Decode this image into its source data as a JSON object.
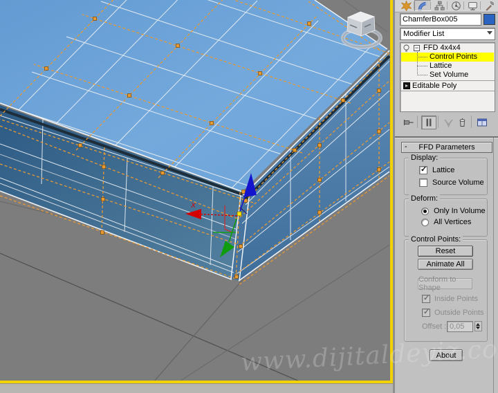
{
  "command_panel": {
    "tabs": [
      {
        "name": "create",
        "icon": "create-icon",
        "active": false
      },
      {
        "name": "modify",
        "icon": "modify-icon",
        "active": true
      },
      {
        "name": "hierarchy",
        "icon": "hierarchy-icon",
        "active": false
      },
      {
        "name": "motion",
        "icon": "motion-icon",
        "active": false
      },
      {
        "name": "display",
        "icon": "display-icon",
        "active": false
      },
      {
        "name": "utilities",
        "icon": "utilities-icon",
        "active": false
      }
    ],
    "object_name": "ChamferBox005",
    "object_color": "#2b63c1",
    "modifier_list_label": "Modifier List",
    "modifier_stack": {
      "modifier": "FFD 4x4x4",
      "sub_items": [
        "Control Points",
        "Lattice",
        "Set Volume"
      ],
      "selected_sub_item": "Control Points",
      "base_object": "Editable Poly"
    },
    "stack_tools": [
      "pin-stack",
      "show-end-result",
      "make-unique",
      "remove-modifier",
      "configure-modifier-sets"
    ],
    "rollout": {
      "collapse_glyph": "-",
      "title": "FFD Parameters",
      "display_group": {
        "label": "Display:",
        "lattice_label": "Lattice",
        "lattice_checked": true,
        "source_volume_label": "Source Volume",
        "source_volume_checked": false
      },
      "deform_group": {
        "label": "Deform:",
        "only_in_volume_label": "Only In Volume",
        "only_in_volume_selected": true,
        "all_vertices_label": "All Vertices",
        "all_vertices_selected": false
      },
      "control_points_group": {
        "label": "Control Points:",
        "reset_label": "Reset",
        "animate_all_label": "Animate All",
        "conform_label": "Conform to Shape",
        "conform_enabled": false,
        "inside_points_label": "Inside Points",
        "inside_points_checked": true,
        "outside_points_label": "Outside Points",
        "outside_points_checked": true,
        "offset_label": "Offset :",
        "offset_value": "0,05"
      },
      "about_label": "About"
    }
  },
  "viewport": {
    "watermark": "www.dijitaldeyiz.com",
    "gizmo": {
      "x_label": "X"
    },
    "colors": {
      "background": "#7d7d7d",
      "box_top": "#6ea6da",
      "box_side_left": "#3c6c99",
      "box_side_right": "#4b7ba8",
      "lattice_orange": "#e69a35",
      "selection_yellow": "#ffff00",
      "active_viewport_border": "#f2d200"
    }
  }
}
